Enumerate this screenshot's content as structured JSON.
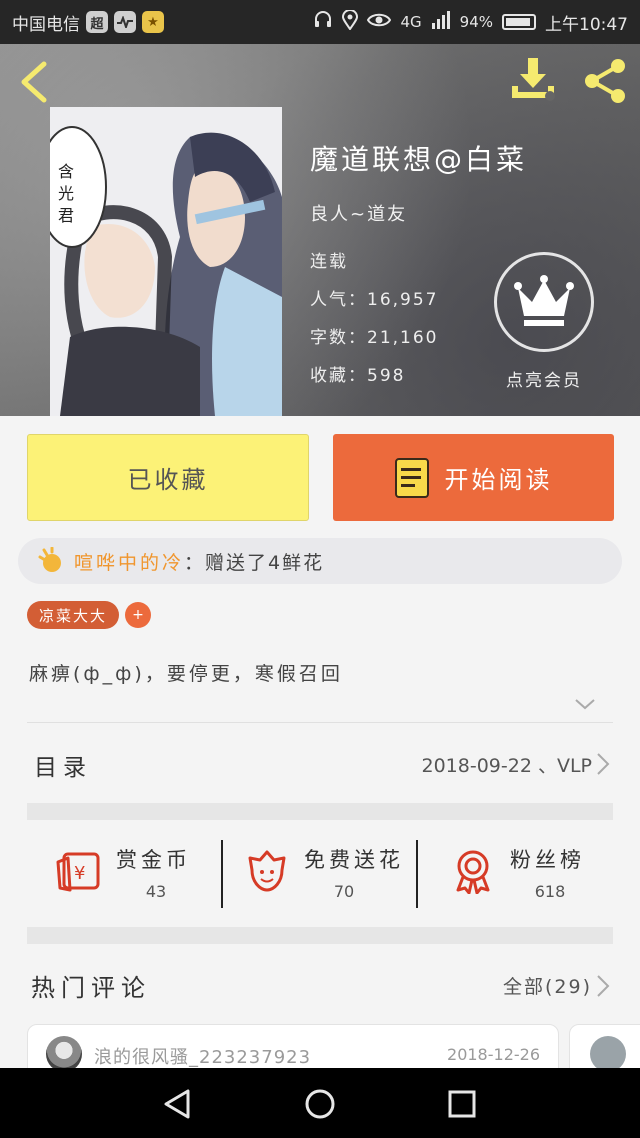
{
  "status_bar": {
    "carrier": "中国电信",
    "badge_1": "超",
    "badge_2": "",
    "badge_3": "",
    "network": "4G",
    "battery": "94%",
    "time": "上午10:47"
  },
  "book": {
    "title": "魔道联想@白菜",
    "author": "良人~道友",
    "status": "连载",
    "popularity": "人气：16,957",
    "word_count": "字数：21,160",
    "favorites": "收藏：598"
  },
  "vip": {
    "label": "点亮会员"
  },
  "actions": {
    "collected_label": "已收藏",
    "read_label": "开始阅读"
  },
  "notice": {
    "user": "喧哗中的冷",
    "text": "：赠送了4鲜花"
  },
  "tags": [
    "凉菜大大"
  ],
  "tag_add": "+",
  "summary": "麻痹(ф_ф)，要停更，寒假召回",
  "toc": {
    "label": "目录",
    "latest": "2018-09-22 、VLP"
  },
  "stats": [
    {
      "label": "赏金币",
      "value": "43"
    },
    {
      "label": "免费送花",
      "value": "70"
    },
    {
      "label": "粉丝榜",
      "value": "618"
    }
  ],
  "comments": {
    "title": "热门评论",
    "all": "全部(29)",
    "items": [
      {
        "user": "浪的很风骚_223237923",
        "date": "2018-12-26"
      }
    ]
  },
  "colors": {
    "accent_orange": "#ec6a3c",
    "collected_yellow": "#fcf277",
    "header_icon_yellow": "#f5ea6f",
    "notice_user": "#f0962e"
  }
}
